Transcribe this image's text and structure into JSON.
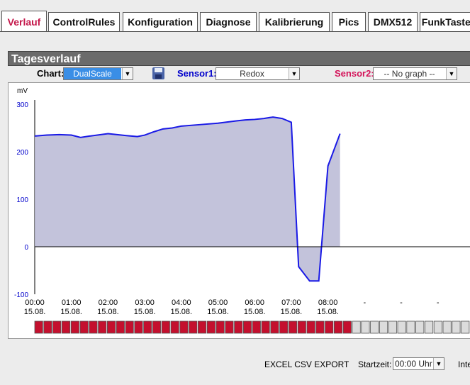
{
  "tabs": [
    {
      "label": "Verlauf",
      "active": true
    },
    {
      "label": "ControlRules",
      "active": false
    },
    {
      "label": "Konfiguration",
      "active": false
    },
    {
      "label": "Diagnose",
      "active": false
    },
    {
      "label": "Kalibrierung",
      "active": false
    },
    {
      "label": "Pics",
      "active": false
    },
    {
      "label": "DMX512",
      "active": false
    },
    {
      "label": "FunkTaster",
      "active": false
    }
  ],
  "panel": {
    "title": "Tagesverlauf",
    "chart_label": "Chart:",
    "chart_mode": "DualScale",
    "sensor1_label": "Sensor1:",
    "sensor1_value": "Redox",
    "sensor2_label": "Sensor2:",
    "sensor2_value": "-- No graph --",
    "save_icon": "floppy-disk-icon"
  },
  "colors": {
    "active_tab": "#c4174a",
    "sensor1": "#0000cc",
    "sensor2": "#d4145a",
    "area_fill": "#b9b9d5",
    "line": "#1a1ae6",
    "progress_filled": "#c4102e",
    "progress_empty": "#dcdcdc"
  },
  "chart_data": {
    "type": "area",
    "y_unit": "mV",
    "ylim": [
      -100,
      300
    ],
    "y_ticks": [
      300,
      200,
      100,
      0,
      -100
    ],
    "x_ticks": [
      {
        "time": "00:00",
        "date": "15.08."
      },
      {
        "time": "01:00",
        "date": "15.08."
      },
      {
        "time": "02:00",
        "date": "15.08."
      },
      {
        "time": "03:00",
        "date": "15.08."
      },
      {
        "time": "04:00",
        "date": "15.08."
      },
      {
        "time": "05:00",
        "date": "15.08."
      },
      {
        "time": "06:00",
        "date": "15.08."
      },
      {
        "time": "07:00",
        "date": "15.08."
      },
      {
        "time": "08:00",
        "date": "15.08."
      },
      {
        "time": "-",
        "date": ""
      },
      {
        "time": "-",
        "date": ""
      },
      {
        "time": "-",
        "date": ""
      }
    ],
    "series": [
      {
        "values": [
          [
            0,
            233
          ],
          [
            0.33,
            235
          ],
          [
            0.67,
            236
          ],
          [
            1.0,
            235
          ],
          [
            1.25,
            230
          ],
          [
            1.5,
            233
          ],
          [
            2.0,
            238
          ],
          [
            2.5,
            234
          ],
          [
            2.8,
            232
          ],
          [
            3.0,
            235
          ],
          [
            3.25,
            242
          ],
          [
            3.5,
            248
          ],
          [
            3.75,
            250
          ],
          [
            4.0,
            254
          ],
          [
            4.5,
            257
          ],
          [
            5.0,
            260
          ],
          [
            5.5,
            265
          ],
          [
            5.75,
            267
          ],
          [
            6.0,
            268
          ],
          [
            6.25,
            270
          ],
          [
            6.5,
            273
          ],
          [
            6.75,
            270
          ],
          [
            7.0,
            262
          ],
          [
            7.2,
            -42
          ],
          [
            7.5,
            -72
          ],
          [
            7.75,
            -72
          ],
          [
            8.0,
            170
          ],
          [
            8.33,
            238
          ]
        ]
      }
    ],
    "grid": false,
    "day_progress": {
      "filled": 35,
      "total": 52
    }
  },
  "footer": {
    "export_label": "EXCEL CSV EXPORT",
    "start_label": "Startzeit:",
    "start_value": "00:00 Uhr",
    "interval_label": "Inte"
  }
}
